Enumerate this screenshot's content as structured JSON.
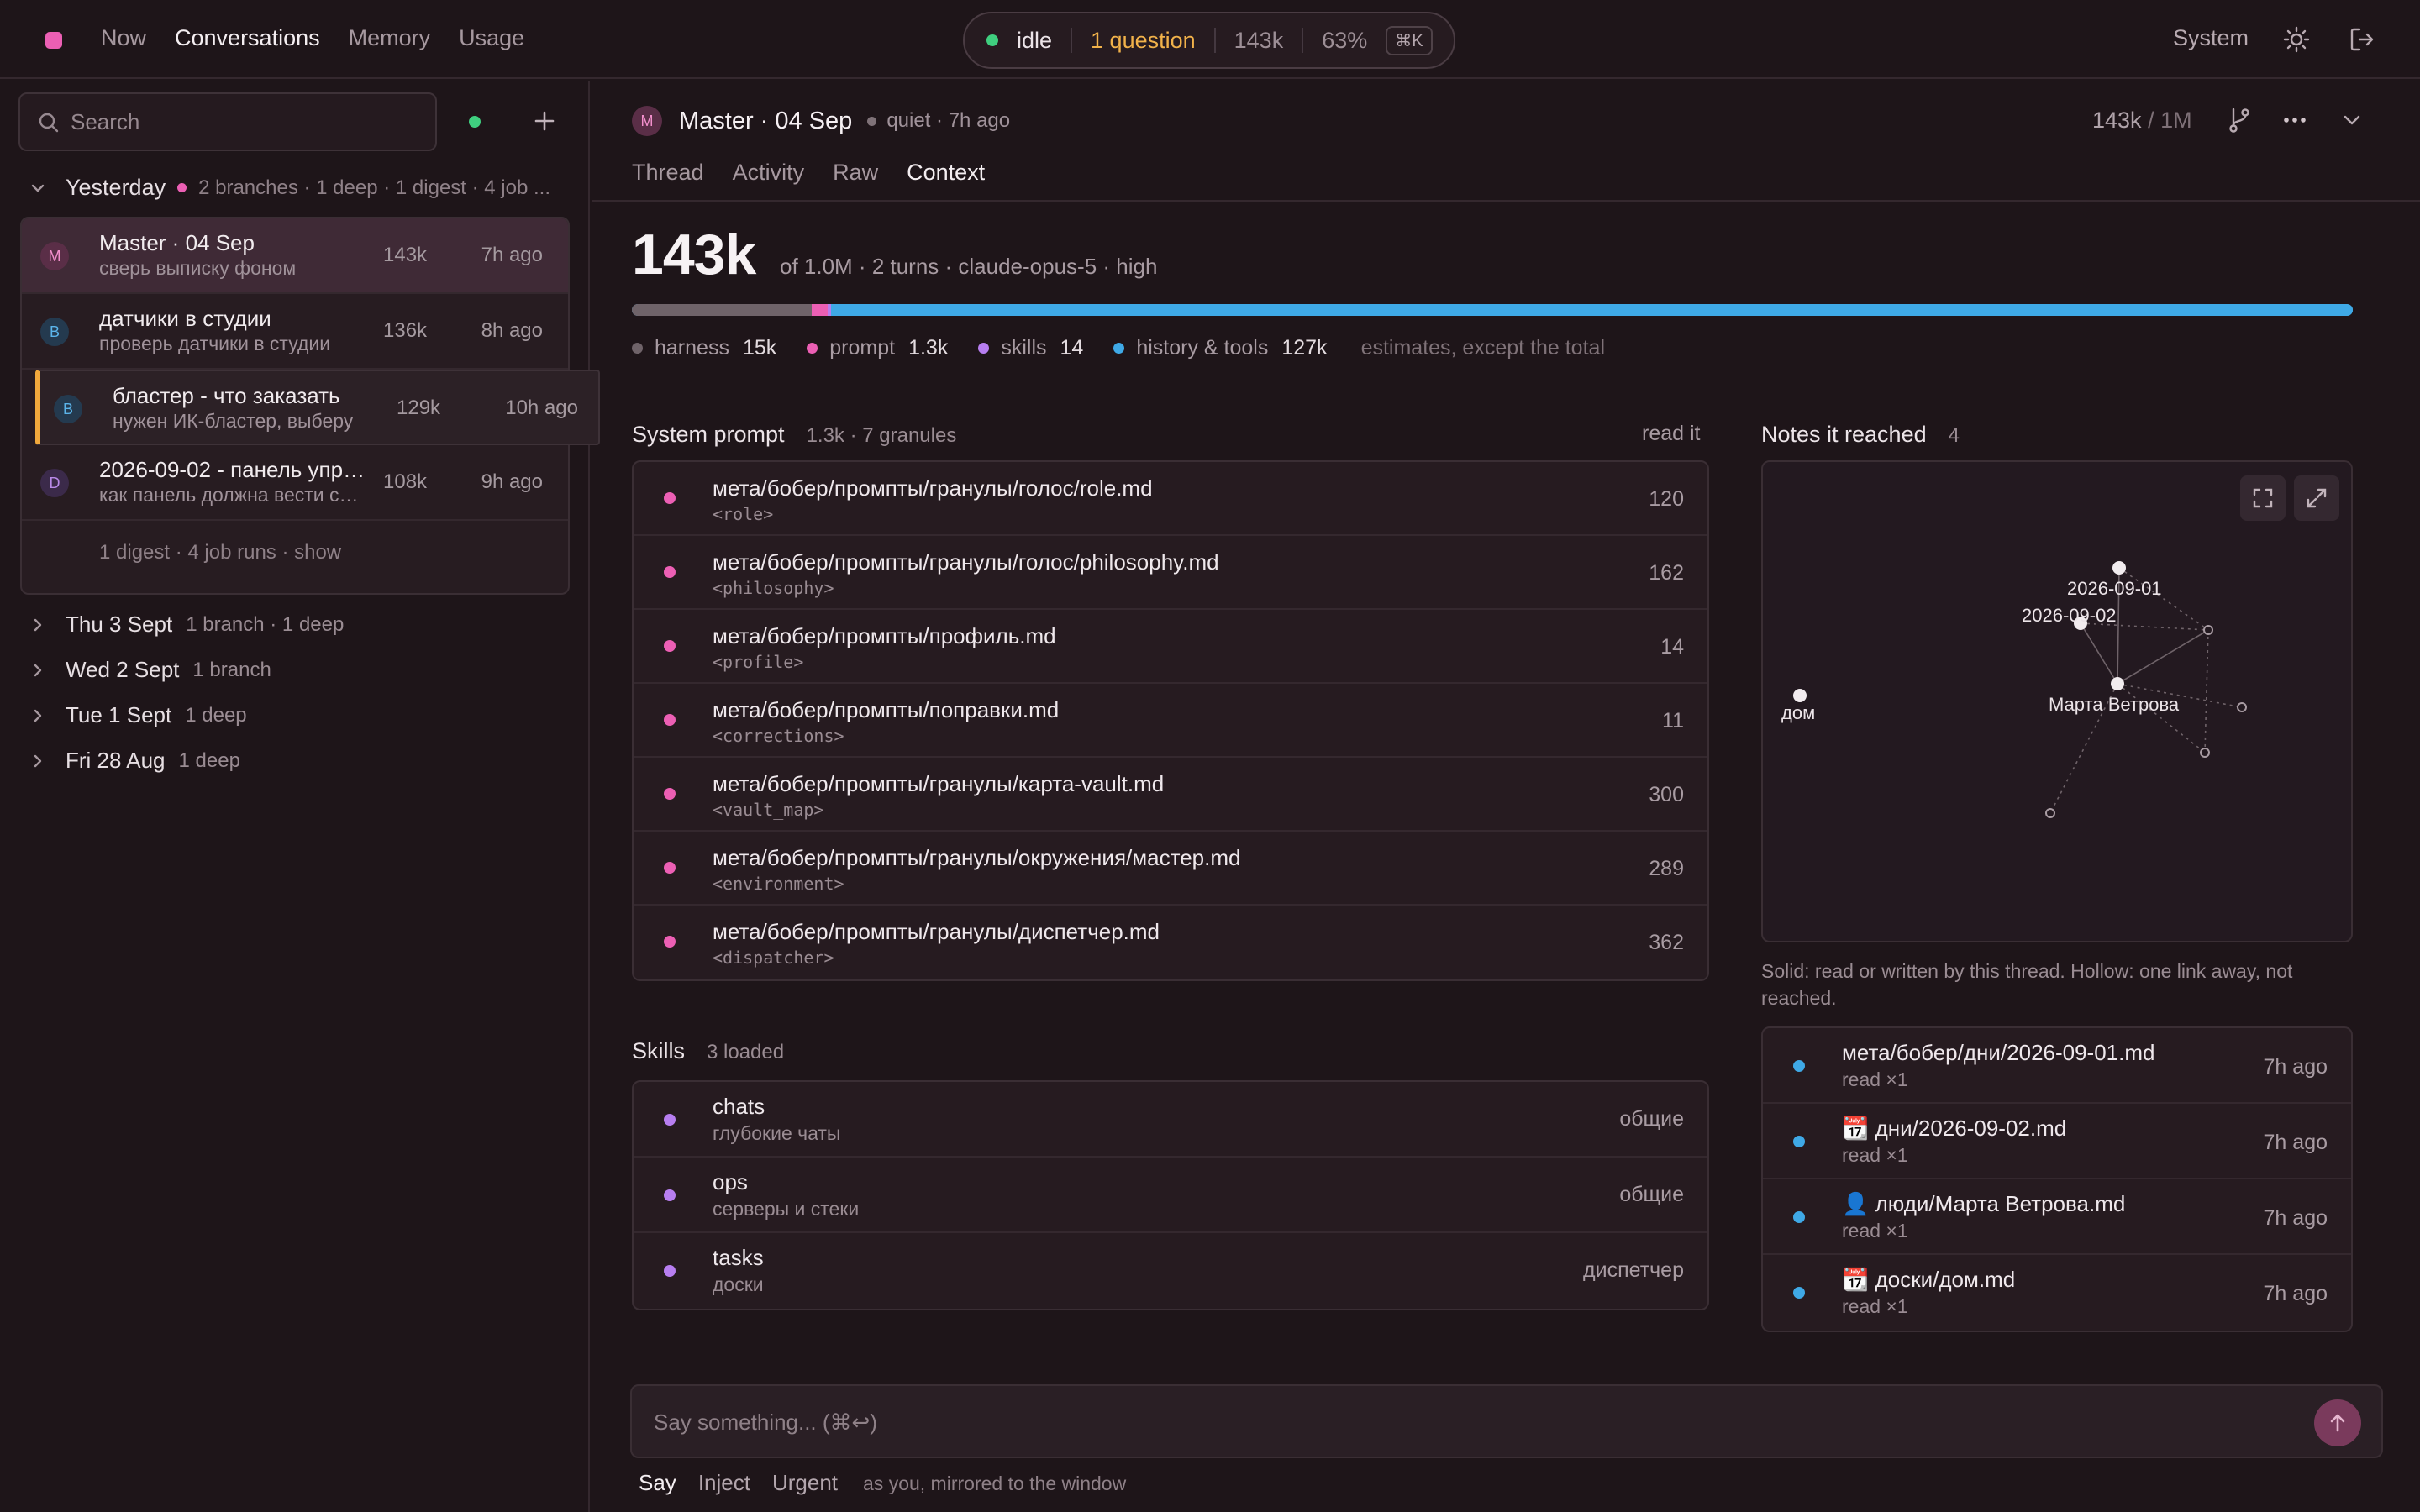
{
  "nav": {
    "items": [
      "Now",
      "Conversations",
      "Memory",
      "Usage"
    ],
    "active": 1
  },
  "status": {
    "state": "idle",
    "questions": "1 question",
    "tokens": "143k",
    "percent": "63%",
    "shortcut": "⌘K"
  },
  "topright": {
    "mode": "System"
  },
  "sidebar": {
    "search_placeholder": "Search",
    "group": {
      "name": "Yesterday",
      "meta": "2 branches · 1 deep · 1 digest · 4 job ..."
    },
    "conversations": [
      {
        "avatar": "M",
        "title": "Master · 04 Sep",
        "subtitle": "сверь выписку фоном",
        "tokens": "143k",
        "age": "7h ago"
      },
      {
        "avatar": "B",
        "title": "датчики в студии",
        "subtitle": "проверь датчики в студии",
        "tokens": "136k",
        "age": "8h ago"
      },
      {
        "avatar": "B",
        "title": "бластер - что заказать",
        "subtitle": "нужен ИК-бластер, выберу",
        "tokens": "129k",
        "age": "10h ago"
      },
      {
        "avatar": "D",
        "title": "2026-09-02 - панель управления",
        "subtitle": "как панель должна вести себя",
        "tokens": "108k",
        "age": "9h ago"
      }
    ],
    "digest": "1 digest · 4 job runs · show",
    "days": [
      {
        "day": "Thu 3 Sept",
        "meta": "1 branch · 1 deep"
      },
      {
        "day": "Wed 2 Sept",
        "meta": "1 branch"
      },
      {
        "day": "Tue 1 Sept",
        "meta": "1 deep"
      },
      {
        "day": "Fri 28 Aug",
        "meta": "1 deep"
      }
    ]
  },
  "header": {
    "avatar": "M",
    "title": "Master · 04 Sep",
    "state": "quiet · 7h ago",
    "tokens": "143k",
    "limit": "/ 1M"
  },
  "tabs": [
    "Thread",
    "Activity",
    "Raw",
    "Context"
  ],
  "context": {
    "total": "143k",
    "meta": "of 1.0M · 2 turns · claude-opus-5 · high",
    "breakdown": [
      {
        "name": "harness",
        "value": "15k",
        "tokens": 15000,
        "color": "#6f6369"
      },
      {
        "name": "prompt",
        "value": "1.3k",
        "tokens": 1300,
        "color": "#ec5fb4"
      },
      {
        "name": "skills",
        "value": "14",
        "tokens": 14,
        "color": "#b77ef0"
      },
      {
        "name": "history & tools",
        "value": "127k",
        "tokens": 127000,
        "color": "#3fa9e6"
      }
    ],
    "estimates_note": "estimates, except the total"
  },
  "system_prompt": {
    "title": "System prompt",
    "summary": "1.3k · 7 granules",
    "action": "read it",
    "items": [
      {
        "path": "мета/бобер/промпты/гранулы/голос/role.md",
        "tag": "<role>",
        "tokens": "120"
      },
      {
        "path": "мета/бобер/промпты/гранулы/голос/philosophy.md",
        "tag": "<philosophy>",
        "tokens": "162"
      },
      {
        "path": "мета/бобер/промпты/профиль.md",
        "tag": "<profile>",
        "tokens": "14"
      },
      {
        "path": "мета/бобер/промпты/поправки.md",
        "tag": "<corrections>",
        "tokens": "11"
      },
      {
        "path": "мета/бобер/промпты/гранулы/карта-vault.md",
        "tag": "<vault_map>",
        "tokens": "300"
      },
      {
        "path": "мета/бобер/промпты/гранулы/окружения/мастер.md",
        "tag": "<environment>",
        "tokens": "289"
      },
      {
        "path": "мета/бобер/промпты/гранулы/диспетчер.md",
        "tag": "<dispatcher>",
        "tokens": "362"
      }
    ]
  },
  "skills": {
    "title": "Skills",
    "summary": "3 loaded",
    "items": [
      {
        "name": "chats",
        "desc": "глубокие чаты",
        "scope": "общие"
      },
      {
        "name": "ops",
        "desc": "серверы и стеки",
        "scope": "общие"
      },
      {
        "name": "tasks",
        "desc": "доски",
        "scope": "диспетчер"
      }
    ]
  },
  "notes": {
    "title": "Notes it reached",
    "count": "4",
    "graph_labels": {
      "n1": "2026-09-01",
      "n2": "2026-09-02",
      "n3": "Марта Ветрова",
      "n4": "дом"
    },
    "legend": "Solid: read or written by this thread. Hollow: one link away, not reached.",
    "items": [
      {
        "icon": "",
        "path": "мета/бобер/дни/2026-09-01.md",
        "action": "read ×1",
        "age": "7h ago"
      },
      {
        "icon": "📆",
        "path": "дни/2026-09-02.md",
        "action": "read ×1",
        "age": "7h ago"
      },
      {
        "icon": "👤",
        "path": "люди/Марта Ветрова.md",
        "action": "read ×1",
        "age": "7h ago"
      },
      {
        "icon": "📆",
        "path": "доски/дом.md",
        "action": "read ×1",
        "age": "7h ago"
      }
    ]
  },
  "composer": {
    "placeholder": "Say something... (⌘↩)",
    "modes": [
      "Say",
      "Inject",
      "Urgent"
    ],
    "note": "as you, mirrored to the window"
  }
}
